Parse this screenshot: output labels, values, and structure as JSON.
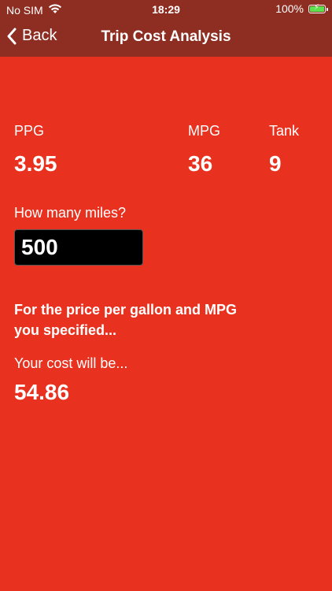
{
  "status_bar": {
    "carrier": "No SIM",
    "time": "18:29",
    "battery_percent": "100%",
    "icons": [
      "wifi-icon",
      "battery-icon"
    ],
    "battery_color": "#5EE04E"
  },
  "nav": {
    "back_label": "Back",
    "title": "Trip Cost Analysis"
  },
  "colors": {
    "background": "#E8321F",
    "header": "#8E2D21",
    "input_bg": "#000000",
    "text": "#FFFFFF"
  },
  "stats": {
    "ppg_label": "PPG",
    "ppg_value": "3.95",
    "mpg_label": "MPG",
    "mpg_value": "36",
    "tank_label": "Tank",
    "tank_value": "9"
  },
  "miles": {
    "label": "How many miles?",
    "value": "500"
  },
  "result": {
    "line1": "For the price per gallon and MPG",
    "line2": "you specified...",
    "cost_label": "Your cost will be...",
    "cost_value": "54.86"
  }
}
